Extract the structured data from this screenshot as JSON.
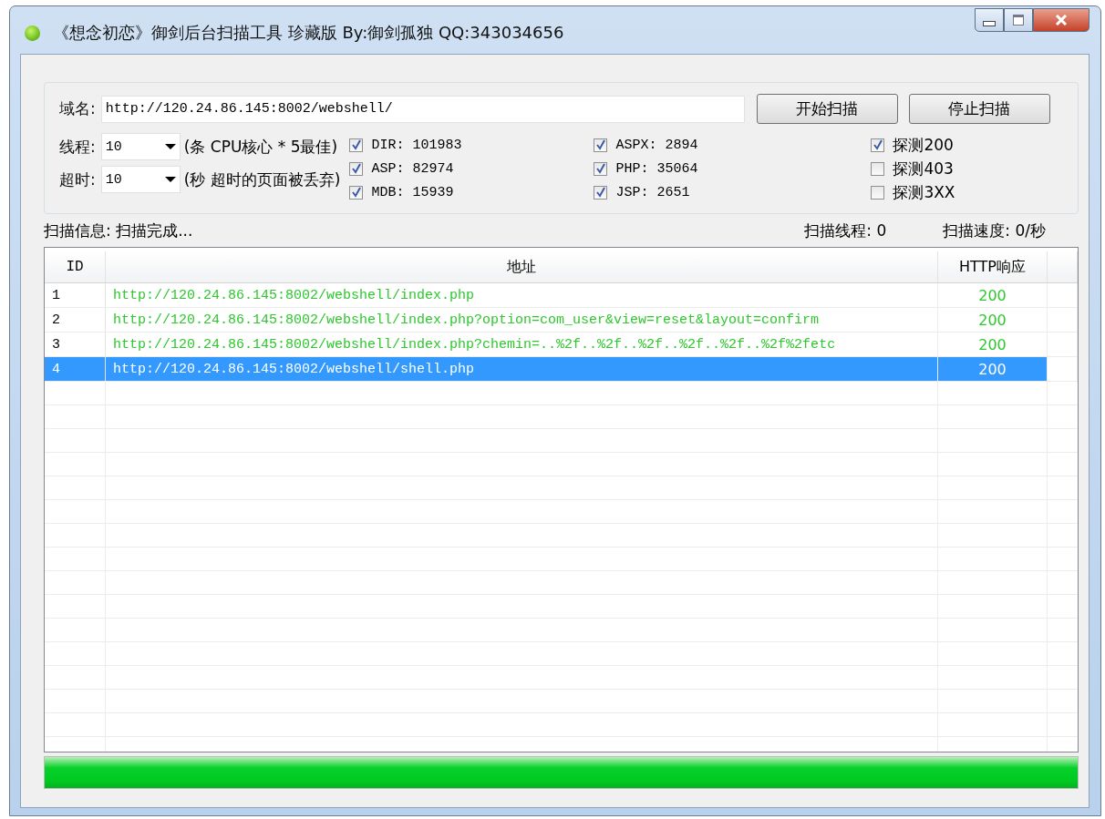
{
  "window": {
    "title": "《想念初恋》御剑后台扫描工具 珍藏版 By:御剑孤独 QQ:343034656"
  },
  "domain": {
    "label": "域名:",
    "value": "http://120.24.86.145:8002/webshell/"
  },
  "buttons": [
    {
      "label": "开始扫描"
    },
    {
      "label": "停止扫描"
    }
  ],
  "threads": {
    "label": "线程:",
    "value": "10",
    "hint": "(条 CPU核心 * 5最佳)"
  },
  "timeout": {
    "label": "超时:",
    "value": "10",
    "hint": "(秒 超时的页面被丢弃)"
  },
  "dictionaries": [
    {
      "label": "DIR: 101983",
      "checked": true
    },
    {
      "label": "ASP: 82974",
      "checked": true
    },
    {
      "label": "MDB: 15939",
      "checked": true
    },
    {
      "label": "ASPX: 2894",
      "checked": true
    },
    {
      "label": "PHP: 35064",
      "checked": true
    },
    {
      "label": "JSP: 2651",
      "checked": true
    }
  ],
  "detect": [
    {
      "label": "探测200",
      "checked": true
    },
    {
      "label": "探测403",
      "checked": false
    },
    {
      "label": "探测3XX",
      "checked": false
    }
  ],
  "status": {
    "info": "扫描信息: 扫描完成...",
    "threads": "扫描线程: 0",
    "speed": "扫描速度: 0/秒"
  },
  "table": {
    "columns": [
      "ID",
      "地址",
      "HTTP响应"
    ],
    "rows": [
      {
        "id": "1",
        "url": "http://120.24.86.145:8002/webshell/index.php",
        "code": "200",
        "selected": false
      },
      {
        "id": "2",
        "url": "http://120.24.86.145:8002/webshell/index.php?option=com_user&view=reset&layout=confirm",
        "code": "200",
        "selected": false
      },
      {
        "id": "3",
        "url": "http://120.24.86.145:8002/webshell/index.php?chemin=..%2f..%2f..%2f..%2f..%2f..%2f%2fetc",
        "code": "200",
        "selected": false
      },
      {
        "id": "4",
        "url": "http://120.24.86.145:8002/webshell/shell.php",
        "code": "200",
        "selected": true
      }
    ]
  },
  "progress": {
    "level": 1
  }
}
